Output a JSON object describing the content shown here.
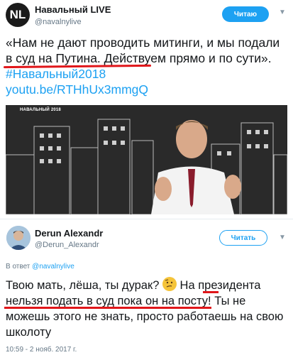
{
  "tweet1": {
    "avatar_letters": "NL",
    "name": "Навальный LIVE",
    "handle": "@navalnylive",
    "follow_label": "Читаю",
    "text_part1": "«Нам не дают проводить митинги, и мы подали в суд на Путина. Действуем прямо и по сути». ",
    "hashtag": "#Навальный2018",
    "link": "youtu.be/RTHhUx3mmgQ",
    "media_title": "НАВАЛЬНЫЙ 2018"
  },
  "tweet2": {
    "name": "Derun Alexandr",
    "handle": "@Derun_Alexandr",
    "follow_label": "Читать",
    "reply_prefix": "В ответ ",
    "reply_handle": "@navalnylive",
    "text_part1": "Твою мать, лёша, ты дурак? ",
    "text_part2": " На президента нельзя подать в суд пока он на посту! Ты не можешь этого не знать, просто работаешь на свою школоту",
    "timestamp": "10:59 - 2 нояб. 2017 г."
  },
  "colors": {
    "accent": "#1da1f2",
    "underline_red": "#e0161a"
  },
  "icons": [
    "chevron-down-icon",
    "thinking-face-icon"
  ]
}
